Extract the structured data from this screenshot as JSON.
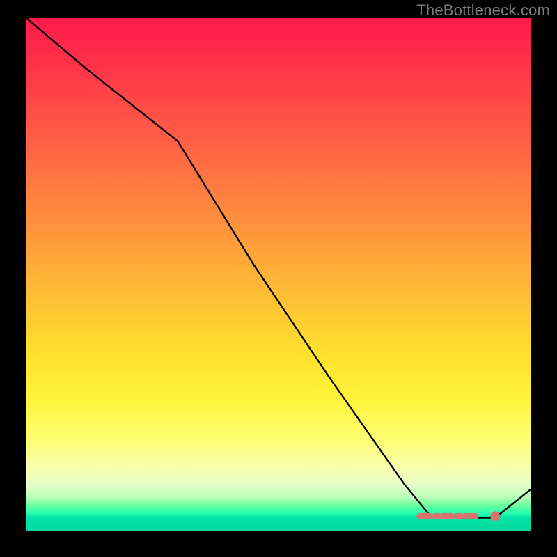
{
  "watermark": "TheBottleneck.com",
  "chart_data": {
    "type": "line",
    "title": "",
    "xlabel": "",
    "ylabel": "",
    "xlim": [
      0,
      100
    ],
    "ylim": [
      0,
      100
    ],
    "grid": false,
    "legend": false,
    "notes": "Approximate values read from an unlabeled gradient plot. The thin black curve starts near the top-left, kinks around x≈30, descends roughly linearly to a flat minimum near x≈80–93, then rises slightly. A short salmon-red marker segment sits on the flat part near the bottom-right with a small dot at its right end.",
    "series": [
      {
        "name": "black-curve",
        "color": "#000000",
        "x": [
          0,
          12,
          30,
          45,
          60,
          75,
          80,
          86,
          93,
          100
        ],
        "y": [
          100,
          90,
          76,
          52,
          30,
          9,
          3,
          2.5,
          2.5,
          8
        ]
      },
      {
        "name": "red-marker-band",
        "color": "#d6736f",
        "x": [
          78,
          93
        ],
        "y": [
          2.8,
          2.8
        ]
      },
      {
        "name": "red-marker-dot",
        "color": "#d6736f",
        "x": [
          93
        ],
        "y": [
          2.8
        ]
      }
    ]
  }
}
